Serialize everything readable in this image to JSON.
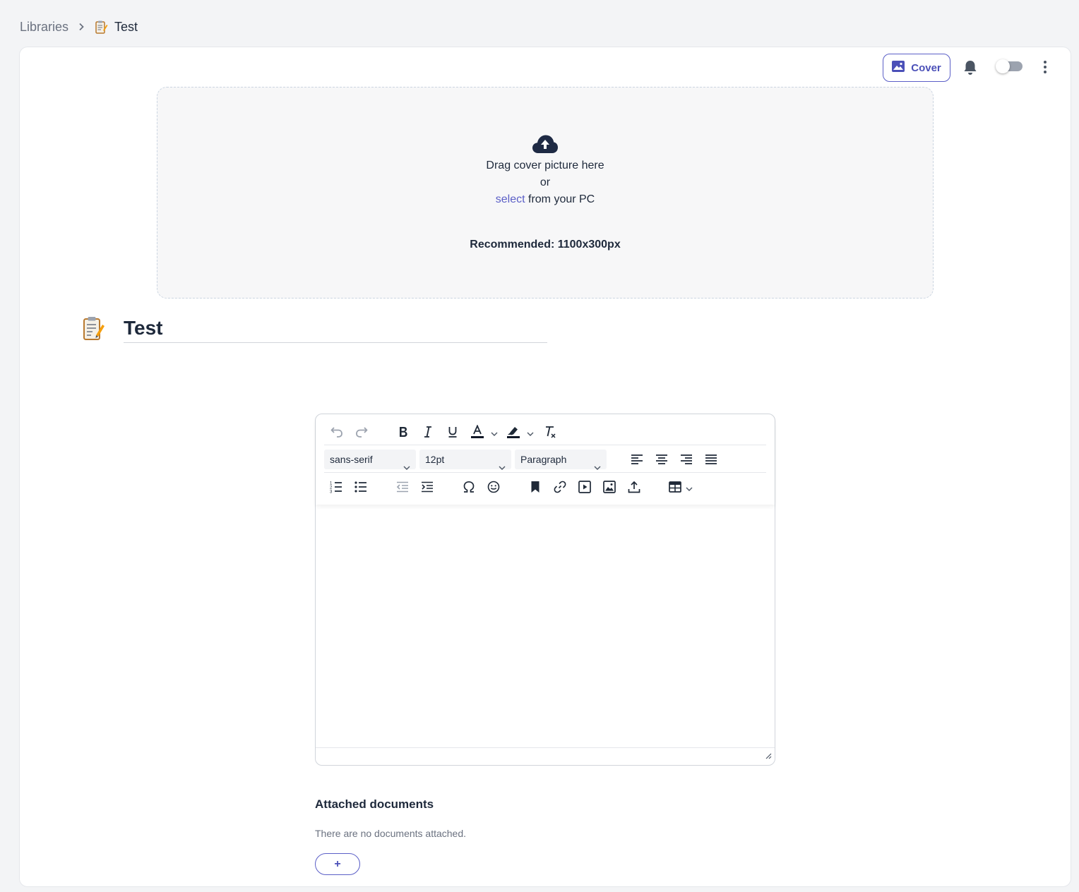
{
  "breadcrumb": {
    "root": "Libraries",
    "current": "Test",
    "current_icon": "clipboard-emoji"
  },
  "toolbar": {
    "cover_label": "Cover"
  },
  "cover": {
    "line1": "Drag cover picture here",
    "line2": "or",
    "select_link": "select",
    "line3_suffix": " from your PC",
    "recommended": "Recommended: 1100x300px"
  },
  "page": {
    "title": "Test",
    "title_icon": "clipboard-emoji"
  },
  "editor": {
    "font_family": "sans-serif",
    "font_size": "12pt",
    "block_format": "Paragraph"
  },
  "attachments": {
    "heading": "Attached documents",
    "empty_text": "There are no documents attached.",
    "add_label": "+"
  },
  "colors": {
    "accent": "#5b5fc7",
    "text": "#1e293b",
    "muted": "#6b7280",
    "background": "#f3f4f6"
  }
}
